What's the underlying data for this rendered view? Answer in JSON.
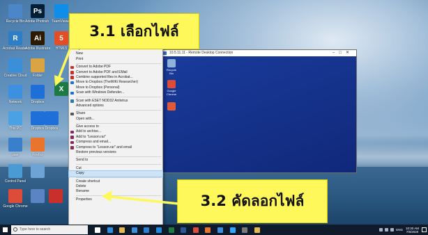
{
  "desktop": {
    "icons": [
      {
        "name": "recycle-bin-icon",
        "label": "Recycle Bin",
        "color": "#4a86c8",
        "glyph": ""
      },
      {
        "name": "photoshop-icon",
        "label": "Adobe Photosh...",
        "color": "#001e36",
        "glyph": "Ps"
      },
      {
        "name": "teamviewer-icon",
        "label": "TeamViewer",
        "color": "#0e8ee9",
        "glyph": ""
      },
      {
        "name": "acrobat-reader-icon",
        "label": "Acrobat Reader DC",
        "color": "#2c7ec9",
        "glyph": "R"
      },
      {
        "name": "illustrator-icon",
        "label": "Adobe Illustrator",
        "color": "#2e1a00",
        "glyph": "Ai"
      },
      {
        "name": "html5-icon",
        "label": "HTML5",
        "color": "#e44d26",
        "glyph": "5"
      },
      {
        "name": "cc-icon",
        "label": "Creative Cloud",
        "color": "#3a8fd8",
        "glyph": ""
      },
      {
        "name": "folder-icon",
        "label": "Folder",
        "color": "#d9a441",
        "glyph": ""
      },
      {
        "name": "excel-file-icon",
        "label": "",
        "color": "#1d7a43",
        "glyph": "X"
      },
      {
        "name": "network-icon",
        "label": "Network",
        "color": "#3d8fe0",
        "glyph": ""
      },
      {
        "name": "dropbox-icon",
        "label": "Dropbox",
        "color": "#1f6fd8",
        "glyph": ""
      },
      {
        "name": "dropbox-icon-2",
        "label": "Dropbox",
        "color": "#1f6fd8",
        "glyph": ""
      },
      {
        "name": "this-pc-icon",
        "label": "This PC",
        "color": "#4aa2e4",
        "glyph": ""
      },
      {
        "name": "dropbox-icon-3",
        "label": "Dropbox",
        "color": "#1f6fd8",
        "glyph": ""
      },
      {
        "name": "user-folder-icon",
        "label": "user",
        "color": "#3a7fcc",
        "glyph": ""
      },
      {
        "name": "firefox-icon",
        "label": "Firefox",
        "color": "#e8752b",
        "glyph": ""
      },
      {
        "name": "control-panel-icon",
        "label": "Control Panel",
        "color": "#4a9ad4",
        "glyph": ""
      },
      {
        "name": "file-icon",
        "label": "",
        "color": "#6ea3d6",
        "glyph": ""
      },
      {
        "name": "chrome-icon",
        "label": "Google Chrome",
        "color": "#dd4b39",
        "glyph": ""
      },
      {
        "name": "anydesk-icon",
        "label": "",
        "color": "#5b84c4",
        "glyph": ""
      },
      {
        "name": "pdf-icon",
        "label": "",
        "color": "#c9302c",
        "glyph": ""
      }
    ]
  },
  "context_menu": {
    "items": [
      {
        "label": "Open",
        "bold": true,
        "icon": "",
        "icon_color": ""
      },
      {
        "label": "New",
        "bold": false,
        "icon": "",
        "icon_color": ""
      },
      {
        "label": "Print",
        "bold": false,
        "icon": "",
        "icon_color": ""
      },
      {
        "sep": true
      },
      {
        "label": "Convert to Adobe PDF",
        "bold": false,
        "icon": "pdf-icon",
        "icon_color": "#c9302c"
      },
      {
        "label": "Convert to Adobe PDF and EMail",
        "bold": false,
        "icon": "pdf-icon",
        "icon_color": "#c9302c"
      },
      {
        "label": "Combine supported files in Acrobat...",
        "bold": false,
        "icon": "acrobat-icon",
        "icon_color": "#c9302c"
      },
      {
        "label": "Move to Dropbox (TheWiKi Researcher)",
        "bold": false,
        "icon": "dropbox-icon",
        "icon_color": "#1f6fd8"
      },
      {
        "label": "Move to Dropbox (Personal)",
        "bold": false,
        "icon": "",
        "icon_color": ""
      },
      {
        "label": "Scan with Windows Defender...",
        "bold": false,
        "icon": "defender-icon",
        "icon_color": "#1f6fd8"
      },
      {
        "sep": true
      },
      {
        "label": "Scan with ESET NOD32 Antivirus",
        "bold": false,
        "icon": "eset-icon",
        "icon_color": "#2a7ab0"
      },
      {
        "label": "Advanced options",
        "bold": false,
        "icon": "",
        "icon_color": ""
      },
      {
        "sep": true
      },
      {
        "label": "Share",
        "bold": false,
        "icon": "share-icon",
        "icon_color": "#555555"
      },
      {
        "label": "Open with...",
        "bold": false,
        "icon": "",
        "icon_color": ""
      },
      {
        "sep": true
      },
      {
        "label": "Give access to",
        "bold": false,
        "icon": "",
        "icon_color": ""
      },
      {
        "label": "Add to archive...",
        "bold": false,
        "icon": "winrar-icon",
        "icon_color": "#8a2a5a"
      },
      {
        "label": "Add to \"Lesson.rar\"",
        "bold": false,
        "icon": "winrar-icon",
        "icon_color": "#8a2a5a"
      },
      {
        "label": "Compress and email...",
        "bold": false,
        "icon": "winrar-icon",
        "icon_color": "#8a2a5a"
      },
      {
        "label": "Compress to \"Lesson.rar\" and email",
        "bold": false,
        "icon": "winrar-icon",
        "icon_color": "#8a2a5a"
      },
      {
        "label": "Restore previous versions",
        "bold": false,
        "icon": "",
        "icon_color": ""
      },
      {
        "sep": true
      },
      {
        "label": "Send to",
        "bold": false,
        "icon": "",
        "icon_color": ""
      },
      {
        "sep": true
      },
      {
        "label": "Cut",
        "bold": false,
        "icon": "",
        "icon_color": ""
      },
      {
        "label": "Copy",
        "bold": false,
        "icon": "",
        "icon_color": "",
        "highlight": true
      },
      {
        "sep": true
      },
      {
        "label": "Create shortcut",
        "bold": false,
        "icon": "",
        "icon_color": ""
      },
      {
        "label": "Delete",
        "bold": false,
        "icon": "",
        "icon_color": ""
      },
      {
        "label": "Rename",
        "bold": false,
        "icon": "",
        "icon_color": ""
      },
      {
        "sep": true
      },
      {
        "label": "Properties",
        "bold": false,
        "icon": "",
        "icon_color": ""
      }
    ]
  },
  "remote_desktop": {
    "title": "10.5.11.11 - Remote Desktop Connection",
    "icons": [
      {
        "name": "rd-recycle-bin-icon",
        "label": "Recycle Bin",
        "color": "#8fb2d8"
      },
      {
        "name": "rd-chrome-icon",
        "label": "Google Chrome",
        "color": "#dd4b39"
      },
      {
        "name": "rd-apps-icon",
        "label": "",
        "color": "#e05a3a"
      }
    ]
  },
  "callouts": {
    "step1": "3.1 เลือกไฟล์",
    "step2": "3.2 คัดลอกไฟล์"
  },
  "taskbar": {
    "search_placeholder": "Type here to search",
    "pinned": [
      {
        "name": "task-view-icon",
        "color": "#ffffff"
      },
      {
        "name": "edge-icon",
        "color": "#2a8fe0"
      },
      {
        "name": "explorer-icon",
        "color": "#e9b84a"
      },
      {
        "name": "store-icon",
        "color": "#3a8fd8"
      },
      {
        "name": "mail-icon",
        "color": "#2a7fd0"
      },
      {
        "name": "teamviewer-task-icon",
        "color": "#1f8ae0"
      },
      {
        "name": "excel-task-icon",
        "color": "#1d7a43"
      },
      {
        "name": "word-task-icon",
        "color": "#2b579a"
      },
      {
        "name": "chrome-task-icon",
        "color": "#dd4b39"
      },
      {
        "name": "firefox-task-icon",
        "color": "#e8752b"
      },
      {
        "name": "remote-desktop-task-icon",
        "color": "#3d8fe0"
      },
      {
        "name": "photoshop-task-icon",
        "color": "#31a8ff"
      },
      {
        "name": "misc-task-icon",
        "color": "#7a7a7a"
      },
      {
        "name": "folder-task-icon",
        "color": "#e9b84a"
      }
    ],
    "time": "10:30 AM",
    "date": "7/5/2020",
    "lang": "ENG"
  }
}
